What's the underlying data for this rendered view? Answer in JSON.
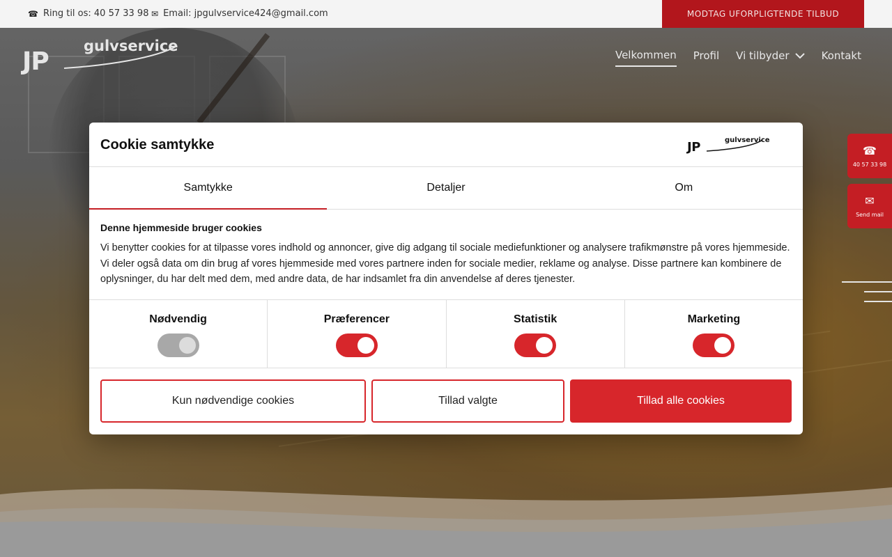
{
  "topbar": {
    "phone_label": "Ring til os: 40 57 33 98",
    "email_label": "Email: jpgulvservice424@gmail.com",
    "cta": "MODTAG UFORPLIGTENDE TILBUD"
  },
  "logo": {
    "initials": "JP",
    "wordmark": "gulvservice"
  },
  "nav": {
    "items": [
      {
        "label": "Velkommen",
        "active": true
      },
      {
        "label": "Profil"
      },
      {
        "label": "Vi tilbyder",
        "has_dropdown": true
      },
      {
        "label": "Kontakt"
      }
    ]
  },
  "side": {
    "phone_label": "40 57 33 98",
    "mail_label": "Send mail"
  },
  "cookie": {
    "title": "Cookie samtykke",
    "logo_initials": "JP",
    "logo_wordmark": "gulvservice",
    "tabs": [
      {
        "label": "Samtykke",
        "active": true
      },
      {
        "label": "Detaljer"
      },
      {
        "label": "Om"
      }
    ],
    "heading": "Denne hjemmeside bruger cookies",
    "text": "Vi benytter cookies for at tilpasse vores indhold og annoncer, give dig adgang til sociale mediefunktioner og analysere trafikmønstre på vores hjemmeside. Vi deler også data om din brug af vores hjemmeside med vores partnere inden for sociale medier, reklame og analyse. Disse partnere kan kombinere de oplysninger, du har delt med dem, med andre data, de har indsamlet fra din anvendelse af deres tjenester.",
    "categories": [
      {
        "label": "Nødvendig",
        "enabled": true,
        "locked": true
      },
      {
        "label": "Præferencer",
        "enabled": true
      },
      {
        "label": "Statistik",
        "enabled": true
      },
      {
        "label": "Marketing",
        "enabled": true
      }
    ],
    "buttons": {
      "necessary_only": "Kun nødvendige cookies",
      "allow_selected": "Tillad valgte",
      "allow_all": "Tillad alle cookies"
    }
  },
  "colors": {
    "accent": "#d7262b",
    "cta_bg": "#b2161c"
  }
}
